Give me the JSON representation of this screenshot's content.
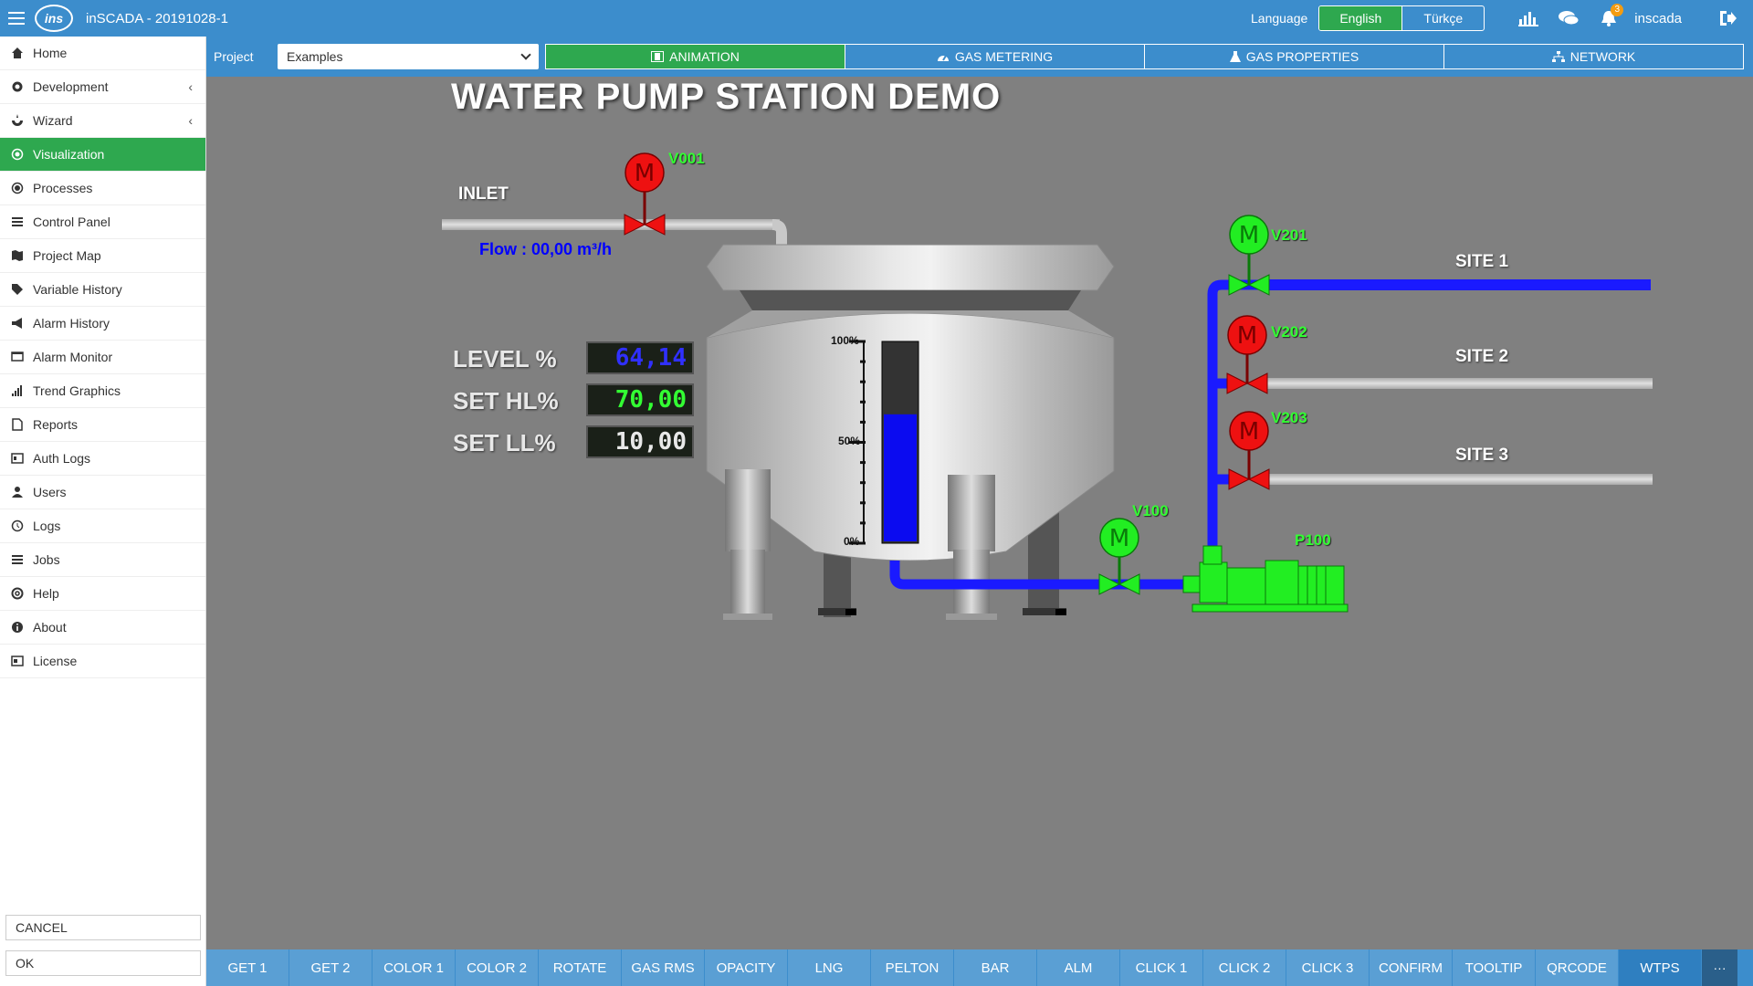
{
  "app": {
    "title": "inSCADA - 20191028-1",
    "logo_text": "ins",
    "language_label": "Language",
    "languages": [
      "English",
      "Türkçe"
    ],
    "active_language": "English",
    "notification_count": "3",
    "user": "inscada"
  },
  "sidebar": {
    "items": [
      {
        "label": "Home",
        "icon": "home-icon"
      },
      {
        "label": "Development",
        "icon": "gear-icon",
        "has_chevron": true
      },
      {
        "label": "Wizard",
        "icon": "wizard-icon",
        "has_chevron": true
      },
      {
        "label": "Visualization",
        "icon": "eye-icon",
        "active": true
      },
      {
        "label": "Processes",
        "icon": "process-icon"
      },
      {
        "label": "Control Panel",
        "icon": "control-panel-icon"
      },
      {
        "label": "Project Map",
        "icon": "map-icon"
      },
      {
        "label": "Variable History",
        "icon": "tag-icon"
      },
      {
        "label": "Alarm History",
        "icon": "bullhorn-icon"
      },
      {
        "label": "Alarm Monitor",
        "icon": "monitor-icon"
      },
      {
        "label": "Trend Graphics",
        "icon": "signal-icon"
      },
      {
        "label": "Reports",
        "icon": "report-icon"
      },
      {
        "label": "Auth Logs",
        "icon": "id-card-icon"
      },
      {
        "label": "Users",
        "icon": "user-icon"
      },
      {
        "label": "Logs",
        "icon": "history-icon"
      },
      {
        "label": "Jobs",
        "icon": "list-icon"
      },
      {
        "label": "Help",
        "icon": "lifebuoy-icon"
      },
      {
        "label": "About",
        "icon": "info-icon"
      },
      {
        "label": "License",
        "icon": "license-icon"
      }
    ],
    "cancel_label": "CANCEL",
    "ok_label": "OK"
  },
  "project_bar": {
    "label": "Project",
    "selected": "Examples",
    "tabs": [
      {
        "label": "ANIMATION",
        "icon": "film-icon",
        "active": true
      },
      {
        "label": "GAS METERING",
        "icon": "dashboard-icon"
      },
      {
        "label": "GAS PROPERTIES",
        "icon": "flask-icon"
      },
      {
        "label": "NETWORK",
        "icon": "sitemap-icon"
      }
    ]
  },
  "scada": {
    "title": "WATER PUMP STATION DEMO",
    "inlet_label": "INLET",
    "flow_text": "Flow : 00,00 m³/h",
    "level_label": "LEVEL %",
    "level_value": "64,14",
    "set_hl_label": "SET HL%",
    "set_hl_value": "70,00",
    "set_ll_label": "SET LL%",
    "set_ll_value": "10,00",
    "tank_level_fraction": 0.6414,
    "scale_labels": [
      "100%",
      "50%",
      "0%"
    ],
    "valves": {
      "v001": {
        "label": "V001",
        "state": "closed"
      },
      "v100": {
        "label": "V100",
        "state": "open"
      },
      "v201": {
        "label": "V201",
        "state": "open"
      },
      "v202": {
        "label": "V202",
        "state": "closed"
      },
      "v203": {
        "label": "V203",
        "state": "closed"
      }
    },
    "motor_symbol": "M",
    "pump_label": "P100",
    "sites": [
      "SITE 1",
      "SITE 2",
      "SITE 3"
    ],
    "colors": {
      "open": "#22ee22",
      "closed": "#ee1111",
      "pipe_active": "#1a1aff",
      "pipe_idle": "#c8c8c8",
      "level_fill": "#0b0bf0"
    }
  },
  "bottom_tabs": [
    "GET 1",
    "GET 2",
    "COLOR 1",
    "COLOR 2",
    "ROTATE",
    "GAS RMS",
    "OPACITY",
    "LNG",
    "PELTON",
    "BAR",
    "ALM",
    "CLICK 1",
    "CLICK 2",
    "CLICK 3",
    "CONFIRM",
    "TOOLTIP",
    "QRCODE",
    "WTPS"
  ],
  "active_bottom_tab": "WTPS",
  "more_label": "···"
}
